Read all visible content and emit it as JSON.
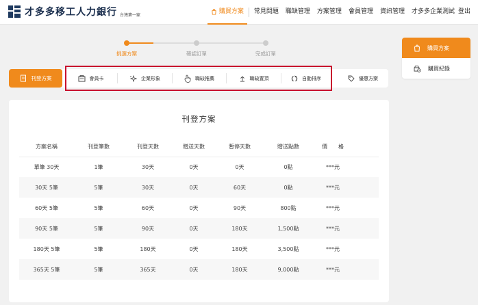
{
  "header": {
    "logo_text": "才多多移工人力銀行",
    "logo_sub": "台灣第一家",
    "nav": [
      {
        "label": "購買方案",
        "active": true
      },
      {
        "label": "常見問題"
      },
      {
        "label": "職缺管理"
      },
      {
        "label": "方案管理"
      },
      {
        "label": "會員管理"
      },
      {
        "label": "資訊管理"
      },
      {
        "label": "才多多企業測試"
      },
      {
        "label": "登出"
      }
    ]
  },
  "steps": [
    {
      "label": "挑選方案",
      "active": true
    },
    {
      "label": "確認訂單"
    },
    {
      "label": "完成訂單"
    }
  ],
  "tabs": {
    "main": "刊登方案",
    "items": [
      {
        "label": "會員卡",
        "icon": "member-card-icon"
      },
      {
        "label": "企業形象",
        "icon": "sparkle-icon"
      },
      {
        "label": "職缺推薦",
        "icon": "hand-pointer-icon"
      },
      {
        "label": "職缺置頂",
        "icon": "arrow-up-icon"
      },
      {
        "label": "自動排序",
        "icon": "sort-icon"
      },
      {
        "label": "優惠方案",
        "icon": "tag-icon"
      }
    ]
  },
  "side": {
    "buy": "購買方案",
    "history": "購買紀錄"
  },
  "card": {
    "title": "刊登方案",
    "columns": [
      "方案名稱",
      "刊登筆數",
      "刊登天數",
      "贈送天數",
      "暫停天數",
      "贈送點數",
      "價　　格"
    ],
    "rows": [
      [
        "單筆 30天",
        "1筆",
        "30天",
        "0天",
        "0天",
        "0點",
        "***元"
      ],
      [
        "30天 5筆",
        "5筆",
        "30天",
        "0天",
        "60天",
        "0點",
        "***元"
      ],
      [
        "60天 5筆",
        "5筆",
        "60天",
        "0天",
        "90天",
        "800點",
        "***元"
      ],
      [
        "90天 5筆",
        "5筆",
        "90天",
        "0天",
        "180天",
        "1,500點",
        "***元"
      ],
      [
        "180天 5筆",
        "5筆",
        "180天",
        "0天",
        "180天",
        "3,500點",
        "***元"
      ],
      [
        "365天 5筆",
        "5筆",
        "365天",
        "0天",
        "180天",
        "9,000點",
        "***元"
      ]
    ]
  },
  "colors": {
    "accent": "#f08a1c",
    "highlight": "#c8102e",
    "price": "#e02020"
  }
}
